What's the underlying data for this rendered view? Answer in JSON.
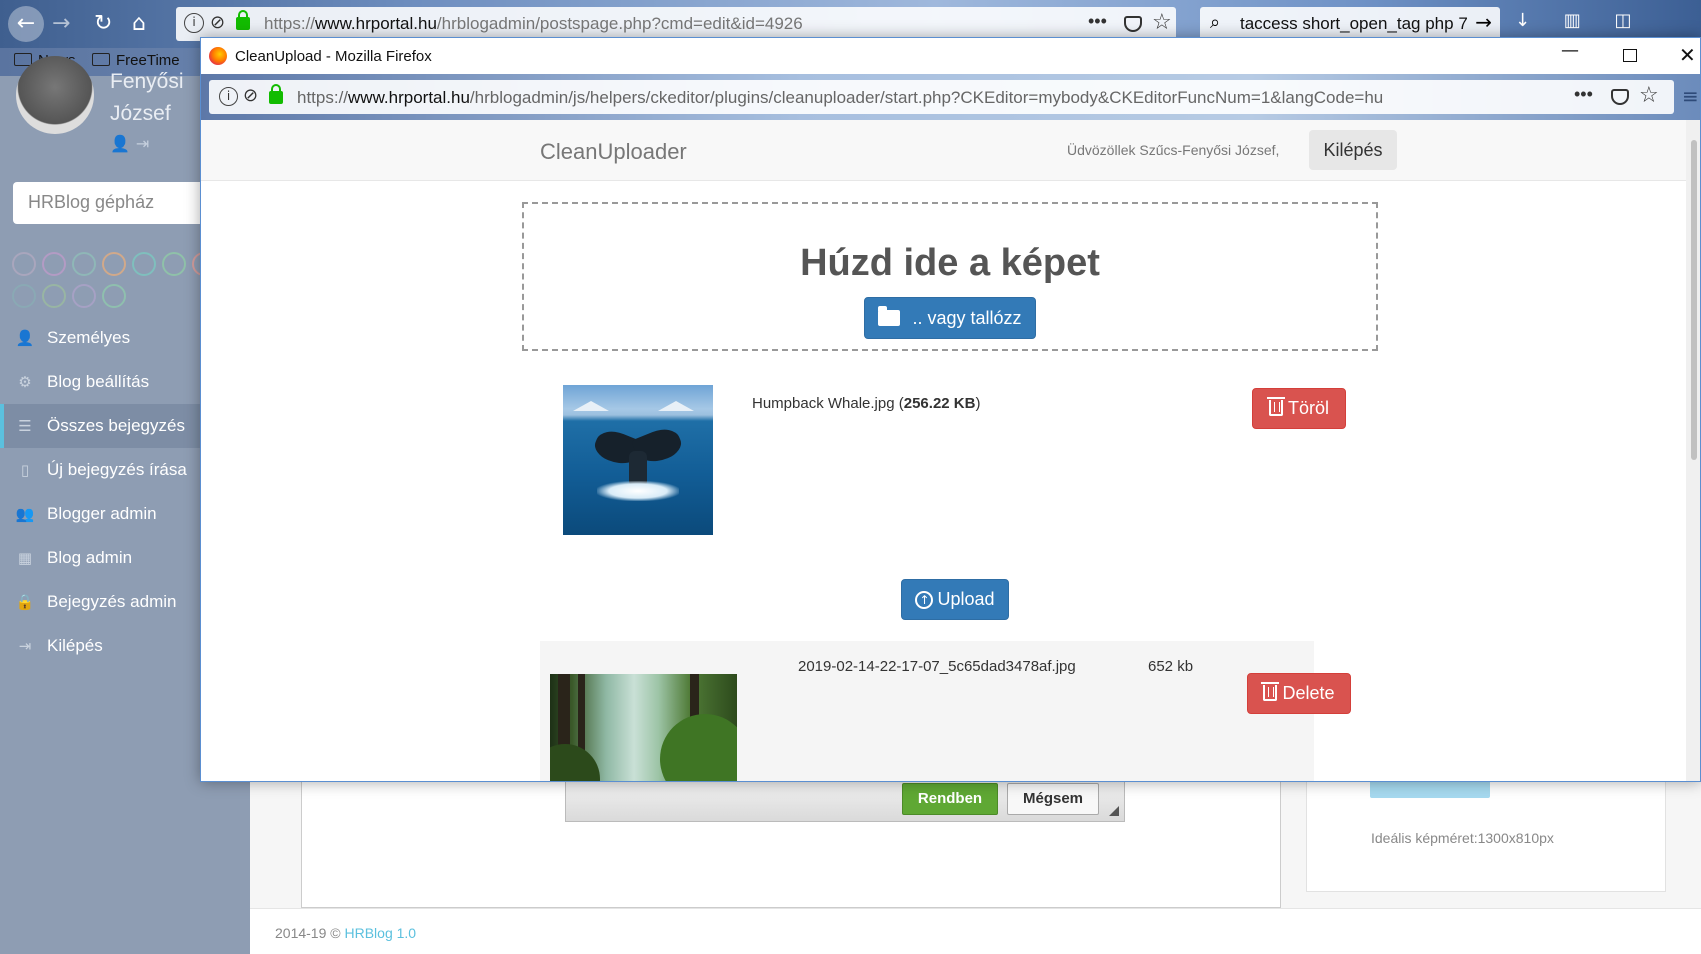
{
  "bg_browser": {
    "url_host": "www.hrportal.hu",
    "url_prefix": "https://",
    "url_path": "/hrblogadmin/postspage.php?cmd=edit&id=4926",
    "search_query": "taccess short_open_tag php 7",
    "bookmarks": [
      "News",
      "FreeTime"
    ]
  },
  "sidebar": {
    "user_name_line1": "Fenyősi",
    "user_name_line2": "József",
    "search_placeholder": "HRBlog gépház",
    "circle_colors": [
      "#a9a6bd",
      "#b39bc4",
      "#8fb7b7",
      "#d1a98a",
      "#7fbfbd",
      "#8fc1a9",
      "#d19c9c",
      "#c99fa8",
      "#8aa9b4",
      "#98b5a3",
      "#a6a1c4",
      "#8fbfae"
    ],
    "items": [
      {
        "label": "Személyes",
        "icon": "user-icon",
        "active": false
      },
      {
        "label": "Blog beállítás",
        "icon": "gear-icon",
        "active": false
      },
      {
        "label": "Összes bejegyzés",
        "icon": "list-icon",
        "active": true
      },
      {
        "label": "Új bejegyzés írása",
        "icon": "file-icon",
        "active": false
      },
      {
        "label": "Blogger admin",
        "icon": "users-icon",
        "active": false
      },
      {
        "label": "Blog admin",
        "icon": "grid-icon",
        "active": false
      },
      {
        "label": "Bejegyzés admin",
        "icon": "lock-icon",
        "active": false
      },
      {
        "label": "Kilépés",
        "icon": "logout-icon",
        "active": false
      }
    ]
  },
  "bg_page": {
    "ok_label": "Rendben",
    "cancel_label": "Mégsem",
    "image_size_hint": "Ideális képméret:1300x810px",
    "footer_copyright": "2014-19 ©",
    "footer_version": "HRBlog 1.0"
  },
  "popup": {
    "window_title": "CleanUpload - Mozilla Firefox",
    "url_prefix": "https://",
    "url_host": "www.hrportal.hu",
    "url_path": "/hrblogadmin/js/helpers/ckeditor/plugins/cleanuploader/start.php?CKEditor=mybody&CKEditorFuncNum=1&langCode=hu"
  },
  "uploader": {
    "brand": "CleanUploader",
    "welcome": "Üdvözöllek Szűcs-Fenyősi József,",
    "logout_label": "Kilépés",
    "drop_title": "Húzd ide a képet",
    "browse_label": ".. vagy tallózz",
    "pending_file": {
      "name": "Humpback Whale.jpg",
      "size": "256.22 KB"
    },
    "remove_label": "Töröl",
    "upload_label": "Upload",
    "server_file": {
      "name": "2019-02-14-22-17-07_5c65dad3478af.jpg",
      "size": "652 kb"
    },
    "delete_label": "Delete"
  }
}
